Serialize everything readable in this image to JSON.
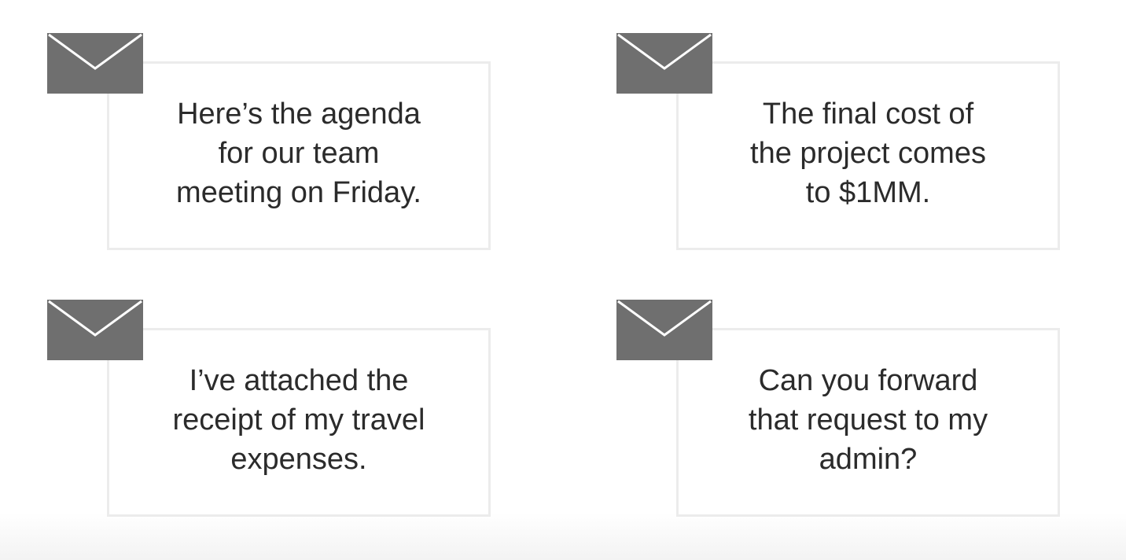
{
  "cards": [
    {
      "icon": "envelope-icon",
      "text": "Here’s the agenda\nfor our team\nmeeting on Friday."
    },
    {
      "icon": "envelope-icon",
      "text": "The final cost of\nthe project comes\nto $1MM."
    },
    {
      "icon": "envelope-icon",
      "text": "I’ve attached the\nreceipt of my travel\nexpenses."
    },
    {
      "icon": "envelope-icon",
      "text": "Can you forward\nthat request to my\nadmin?"
    }
  ],
  "colors": {
    "envelope": "#6f6f6f",
    "envelope_flap_line": "#ffffff",
    "card_border": "#ececec",
    "text": "#2b2b2b"
  }
}
